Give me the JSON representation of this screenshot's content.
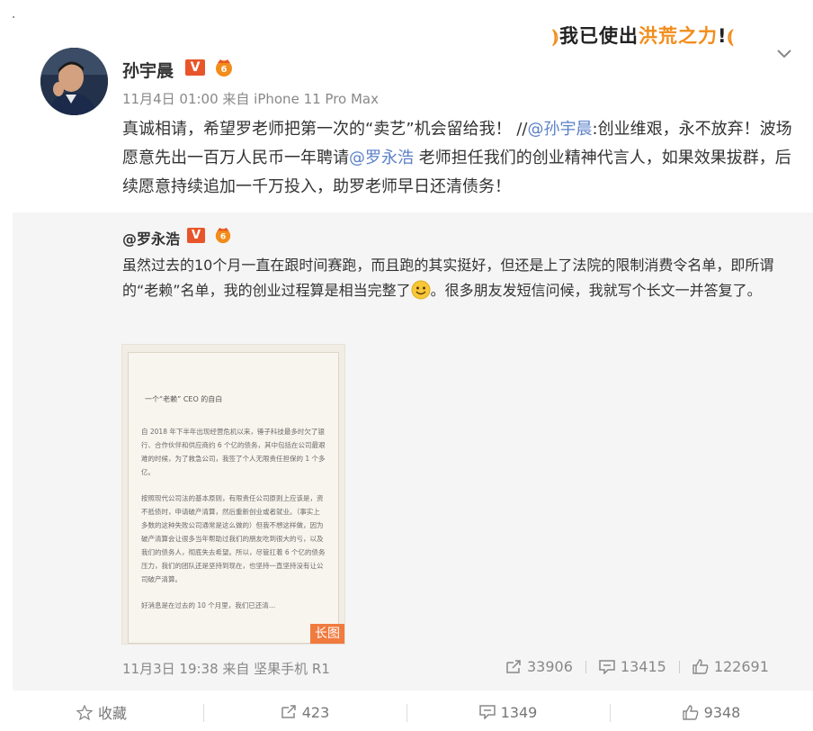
{
  "banner": {
    "slogan_pre": "我已使出",
    "slogan_hl": "洪荒之力",
    "slogan_mark": "!",
    "deco_left": "⦆",
    "deco_right": "⦅"
  },
  "post": {
    "author": "孙宇晨",
    "v_badge": "V",
    "meta": "11月4日 01:00 来自 iPhone 11 Pro Max",
    "text_1": "真诚相请，希望罗老师把第一次的“卖艺”机会留给我！ //",
    "mention_1": "@孙宇晨",
    "text_2": ":创业维艰，永不放弃！波场愿意先出一百万人民币一年聘请",
    "mention_2": "@罗永浩",
    "text_3": " 老师担任我们的创业精神代言人，如果效果拔群，后续愿意持续追加一千万投入，助罗老师早日还清债务！"
  },
  "quoted": {
    "author": "@罗永浩",
    "v_badge": "V",
    "text_1": "虽然过去的10个月一直在跟时间赛跑，而且跑的其实挺好，但还是上了法院的限制消费令名单，即所谓的“老赖”名单，我的创业过程算是相当完整了",
    "text_2": "。很多朋友发短信问候，我就写个长文一并答复了。",
    "image_tag": "长图",
    "doc_title": "一个“老赖” CEO 的自白",
    "doc_paragraphs": [
      "自 2018 年下半年出现经营危机以来，锤子科技最多时欠了银行、合作伙伴和供应商约 6 个亿的债务，其中包括在公司最艰难的时候，为了救急公司，我签了个人无限责任担保的 1 个多亿。",
      "按照现代公司法的基本原则，有限责任公司原则上应该是，资不抵债时，申请破产清算，然后重新创业或者就业。（事实上多数的这种失败公司通常是这么做的）但我不想这样做，因为破产清算会让很多当年帮助过我们的朋友吃到很大的亏，以及我们的债务人，彻底失去希望。所以，尽管扛着 6 个亿的债务压力，我们的团队还是坚持到现在，也坚持一直坚持没有让公司破产清算。",
      "好消息是在过去的 10 个月里，我们已还清…"
    ],
    "meta": "11月3日 19:38 来自 坚果手机 R1",
    "reposts": "33906",
    "comments": "13415",
    "likes": "122691"
  },
  "actions": {
    "favorite": "收藏",
    "repost": "423",
    "comment": "1349",
    "like": "9348"
  }
}
